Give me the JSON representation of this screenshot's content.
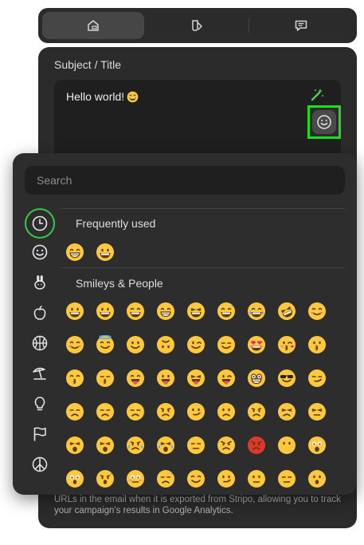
{
  "colors": {
    "panel_bg": "#2b2b2b",
    "input_bg": "#1f1f1f",
    "active_ring": "#38c84c",
    "highlight": "#19e019",
    "emoji_face": "#ffc83d"
  },
  "tabs": [
    {
      "icon": "content-block-icon",
      "active": true
    },
    {
      "icon": "paint-bucket-icon",
      "active": false
    },
    {
      "icon": "message-icon",
      "active": false
    }
  ],
  "subject": {
    "label": "Subject / Title",
    "value": "Hello world!",
    "value_emoji": "grinning-smiling-eyes",
    "wand_icon": "magic-wand-icon",
    "emoji_button_icon": "smiley-icon"
  },
  "picker": {
    "search_placeholder": "Search",
    "categories": [
      "recent-clock-icon",
      "smiley-face-icon",
      "bunny-icon",
      "apple-icon",
      "basketball-icon",
      "beach-umbrella-icon",
      "lightbulb-icon",
      "flag-icon",
      "peace-symbol-icon"
    ],
    "sections": [
      {
        "title": "Frequently used",
        "rows": [
          [
            "grin",
            "grinning"
          ]
        ]
      },
      {
        "title": "Smileys & People",
        "rows": [
          [
            "grinning",
            "smiley",
            "smile",
            "grin",
            "laughing",
            "sweat-smile",
            "joy",
            "rofl",
            "blush"
          ],
          [
            "relaxed",
            "innocent",
            "slight-smile",
            "upside-down",
            "wink",
            "relieved",
            "heart-eyes",
            "kissing-heart",
            "kissing"
          ],
          [
            "kissing-smiling",
            "kissing-closed",
            "yum",
            "tongue",
            "tongue-closed",
            "tongue-wink",
            "nerd",
            "sunglasses",
            "smirk"
          ],
          [
            "unamused",
            "pensive",
            "disappointed",
            "worried",
            "confused",
            "frowning",
            "frowning2",
            "persevere",
            "confounded"
          ],
          [
            "tired",
            "weary",
            "cry",
            "sob",
            "triumph",
            "angry",
            "rage",
            "no-mouth",
            "scream"
          ],
          [
            "fearful",
            "cold-sweat",
            "flushed",
            "sweat",
            "hugging",
            "thinking",
            "neutral",
            "expressionless",
            "hushed"
          ]
        ]
      }
    ]
  },
  "footer": {
    "text": "URLs in the email when it is exported from Stripo, allowing you to track your campaign's results in Google Analytics."
  }
}
